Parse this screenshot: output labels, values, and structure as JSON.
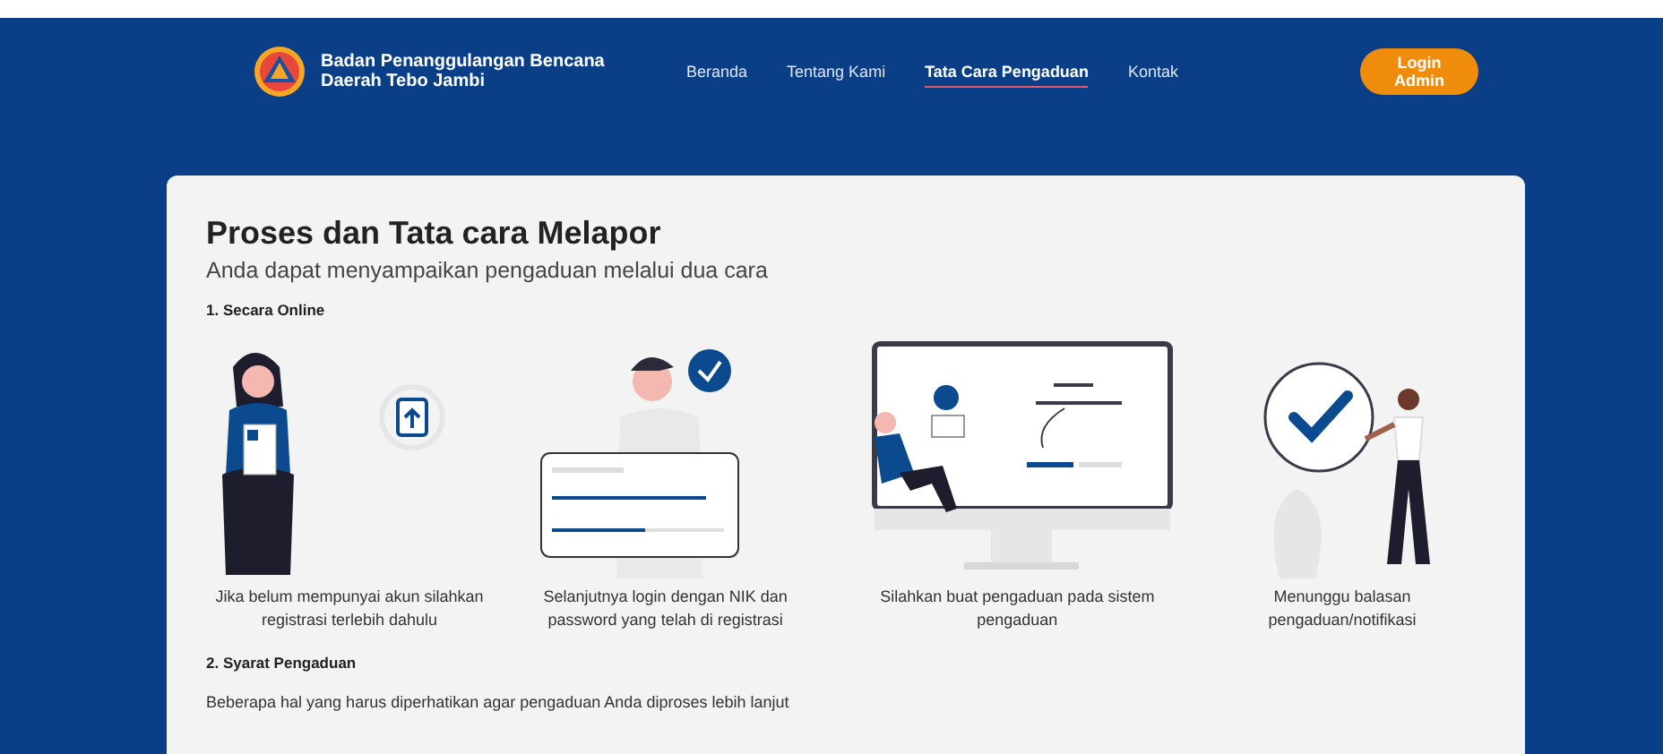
{
  "header": {
    "org_name": "Badan Penanggulangan Bencana Daerah Tebo Jambi",
    "nav": [
      {
        "label": "Beranda",
        "selected": false
      },
      {
        "label": "Tentang Kami",
        "selected": false
      },
      {
        "label": "Tata Cara Pengaduan",
        "selected": true
      },
      {
        "label": "Kontak",
        "selected": false
      }
    ],
    "login_button": "Login Admin"
  },
  "content": {
    "title": "Proses dan Tata cara Melapor",
    "subtitle": "Anda dapat menyampaikan pengaduan melalui dua cara",
    "section_1": "1. Secara Online",
    "steps": [
      {
        "kind": "register",
        "caption": "Jika belum mempunyai akun silahkan registrasi terlebih dahulu"
      },
      {
        "kind": "login",
        "caption": "Selanjutnya login dengan NIK dan password yang telah di registrasi"
      },
      {
        "kind": "report",
        "caption": "Silahkan buat pengaduan pada sistem pengaduan"
      },
      {
        "kind": "wait",
        "caption": "Menunggu balasan pengaduan/notifikasi"
      }
    ],
    "section_2": "2. Syarat Pengaduan",
    "section_2_text": "Beberapa hal yang harus diperhatikan agar pengaduan Anda diproses lebih lanjut"
  }
}
